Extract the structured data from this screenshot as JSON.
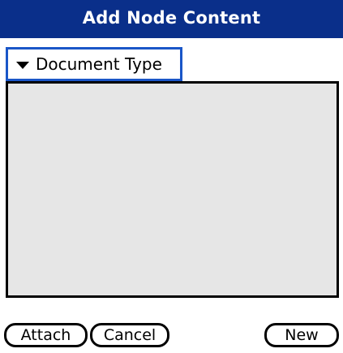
{
  "window": {
    "title": "Add Node Content"
  },
  "picker": {
    "label": "Document Type",
    "icon": "triangle-down-icon"
  },
  "list": {
    "items": []
  },
  "buttons": {
    "attach": "Attach",
    "cancel": "Cancel",
    "new": "New"
  },
  "colors": {
    "title_bar": "#0a2f8a",
    "picker_border": "#1a56c8",
    "list_background": "#e6e6e6"
  }
}
